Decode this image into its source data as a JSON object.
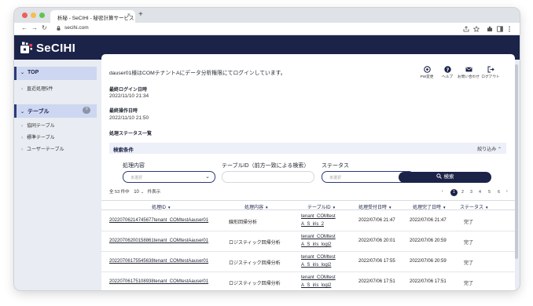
{
  "browser": {
    "tab_title": "析秘 - SeCIHI - 秘密計算サービス",
    "tab_close": "×",
    "new_tab": "+",
    "url": "secihi.com",
    "nav": {
      "back": "←",
      "forward": "→",
      "reload": "↻"
    }
  },
  "app": {
    "logo_text": "SeCIHI"
  },
  "sidebar": {
    "sections": [
      {
        "label": "TOP",
        "items": [
          {
            "label": "直近処理5件"
          }
        ]
      },
      {
        "label": "テーブル",
        "badge": "?",
        "items": [
          {
            "label": "協同テーブル"
          },
          {
            "label": "標準テーブル"
          },
          {
            "label": "ユーザーテーブル"
          }
        ]
      }
    ]
  },
  "header": {
    "welcome": "dauser01様はCOMテナントAにデータ分析権限にてログインしています。",
    "tools": [
      {
        "label": "PW変更",
        "icon": "password-icon"
      },
      {
        "label": "ヘルプ",
        "icon": "help-icon"
      },
      {
        "label": "お問い合わせ",
        "icon": "mail-icon"
      },
      {
        "label": "ログアウト",
        "icon": "logout-icon"
      }
    ]
  },
  "meta": {
    "last_login_label": "最終ログイン日時",
    "last_login_value": "2022/11/10 21:34",
    "last_op_label": "最終操作日時",
    "last_op_value": "2022/11/10 21:50",
    "status_list_title": "処理ステータス一覧"
  },
  "search": {
    "title": "検索条件",
    "collapse_label": "絞り込み",
    "process_label": "処理内容",
    "process_placeholder": "未選択",
    "table_id_label": "テーブルID（前方一致による検索）",
    "table_id_value": "",
    "status_label": "ステータス",
    "status_placeholder": "未選択",
    "button_label": "検索"
  },
  "list": {
    "count_text": "全 53 件中",
    "per_page": "10",
    "per_page_unit": "件表示",
    "pagination": {
      "prev": "‹",
      "next": "›",
      "pages": [
        "1",
        "2",
        "3",
        "4",
        "5",
        "6"
      ],
      "current": "1"
    }
  },
  "table": {
    "columns": [
      "処理ID",
      "処理内容",
      "テーブルID",
      "処理受付日時",
      "処理完了日時",
      "ステータス"
    ],
    "rows": [
      {
        "id": "20220706214745677tenant_COMtestAauser01",
        "process": "線形回帰分析",
        "table_id_1": "tenant_COMtest",
        "table_id_2": "A_S_iris_2",
        "received": "2022/07/06 21:47",
        "completed": "2022/07/06 21:47",
        "status": "完了"
      },
      {
        "id": "20220706200158861tenant_COMtestAauser01",
        "process": "ロジスティック回帰分析",
        "table_id_1": "tenant_COMtest",
        "table_id_2": "A_S_iris_logi2",
        "received": "2022/07/06 20:01",
        "completed": "2022/07/06 20:59",
        "status": "完了"
      },
      {
        "id": "20220706175545638tenant_COMtestAauser01",
        "process": "ロジスティック回帰分析",
        "table_id_1": "tenant_COMtest",
        "table_id_2": "A_S_iris_logi2",
        "received": "2022/07/06 17:55",
        "completed": "2022/07/06 20:59",
        "status": "完了"
      },
      {
        "id": "20220706175108938tenant_COMtestAauser01",
        "process": "ロジスティック回帰分析",
        "table_id_1": "tenant_COMtest",
        "table_id_2": "A_S_iris_logi2",
        "received": "2022/07/06 17:51",
        "completed": "2022/07/06 17:51",
        "status": "完了"
      }
    ]
  }
}
